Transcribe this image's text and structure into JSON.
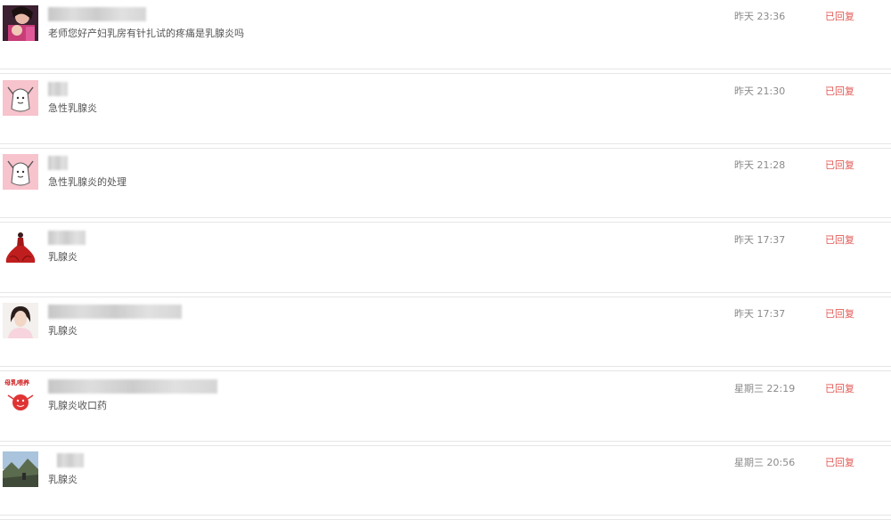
{
  "conversations": [
    {
      "avatar": "woman-with-baby-avatar",
      "message": "老师您好产妇乳房有针扎试的疼痛是乳腺炎吗",
      "time": "昨天 23:36",
      "status": "已回复"
    },
    {
      "avatar": "pink-cartoon-avatar",
      "message": "急性乳腺炎",
      "time": "昨天 21:30",
      "status": "已回复"
    },
    {
      "avatar": "pink-cartoon-avatar",
      "message": "急性乳腺炎的处理",
      "time": "昨天 21:28",
      "status": "已回复"
    },
    {
      "avatar": "red-dress-avatar",
      "message": "乳腺炎",
      "time": "昨天 17:37",
      "status": "已回复"
    },
    {
      "avatar": "woman-portrait-avatar",
      "message": "乳腺炎",
      "time": "昨天 17:37",
      "status": "已回复"
    },
    {
      "avatar": "cartoon-logo-avatar",
      "avatar_text": "母乳喂养",
      "message": "乳腺炎收口药",
      "time": "星期三 22:19",
      "status": "已回复"
    },
    {
      "avatar": "landscape-photo-avatar",
      "message": "乳腺炎",
      "time": "星期三 20:56",
      "status": "已回复"
    }
  ]
}
